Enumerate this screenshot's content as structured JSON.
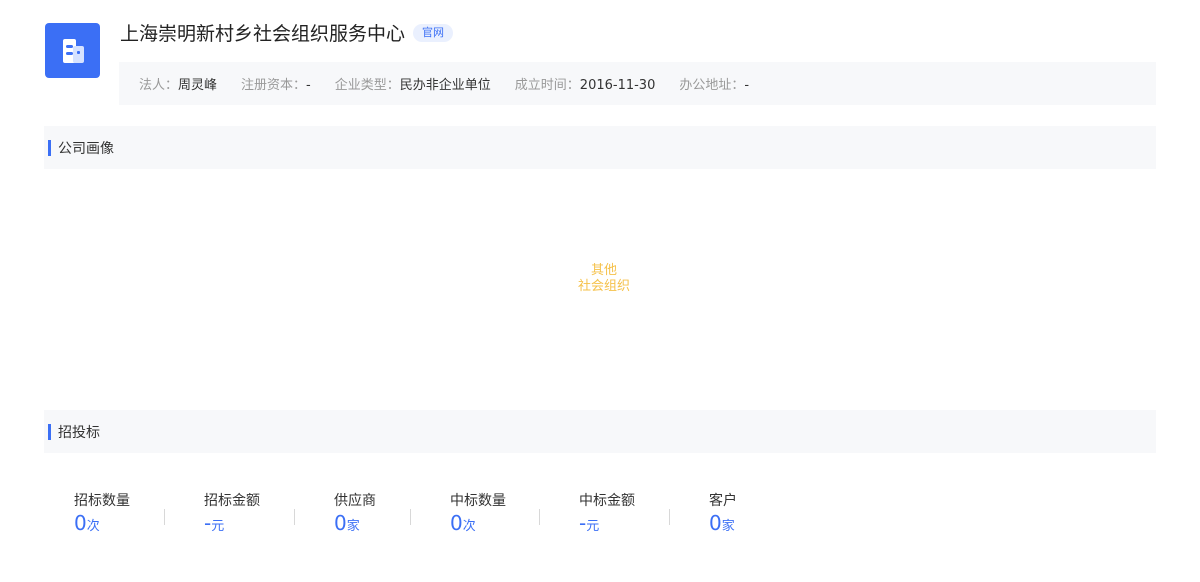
{
  "company": {
    "name": "上海崇明新村乡社会组织服务中心",
    "badge": "官网"
  },
  "info": [
    {
      "label": "法人：",
      "value": "周灵峰"
    },
    {
      "label": "注册资本：",
      "value": "-"
    },
    {
      "label": "企业类型：",
      "value": "民办非企业单位"
    },
    {
      "label": "成立时间：",
      "value": "2016-11-30"
    },
    {
      "label": "办公地址：",
      "value": "-"
    }
  ],
  "sections": {
    "portrait_title": "公司画像",
    "bidding_title": "招投标"
  },
  "portrait": {
    "line1": "其他",
    "line2": "社会组织"
  },
  "stats": [
    {
      "label": "招标数量",
      "value": "0",
      "unit": "次"
    },
    {
      "label": "招标金额",
      "value": "-",
      "unit": "元"
    },
    {
      "label": "供应商",
      "value": "0",
      "unit": "家"
    },
    {
      "label": "中标数量",
      "value": "0",
      "unit": "次"
    },
    {
      "label": "中标金额",
      "value": "-",
      "unit": "元"
    },
    {
      "label": "客户",
      "value": "0",
      "unit": "家"
    }
  ],
  "colors": {
    "accent": "#3b6ff5",
    "portrait_text": "#f5c14a",
    "section_bg": "#f7f8fa"
  },
  "icons": {
    "logo": "building-icon"
  }
}
